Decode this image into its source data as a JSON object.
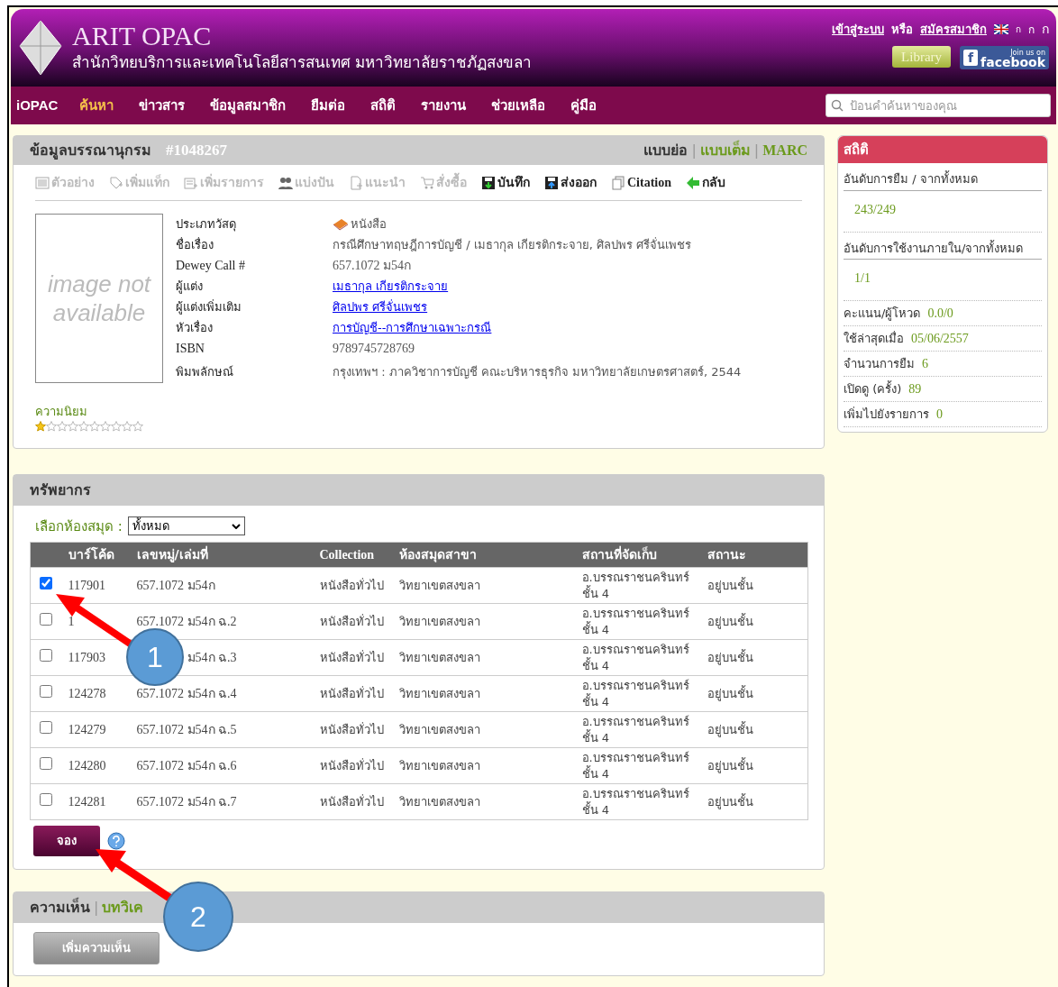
{
  "header": {
    "title": "ARIT OPAC",
    "subtitle": "สำนักวิทยบริการและเทคโนโลยีสารสนเทศ มหาวิทยาลัยราชภัฏสงขลา",
    "login": "เข้าสู่ระบบ",
    "or": "หรือ",
    "register": "สมัครสมาชิก",
    "lang_options": [
      "ก",
      "ก",
      "ก"
    ],
    "library_button": "Library",
    "facebook_letter": "f",
    "facebook_small": "Join us on",
    "facebook": "facebook"
  },
  "nav": {
    "brand": "iOPAC",
    "items": [
      {
        "label": "ค้นหา",
        "selected": true
      },
      {
        "label": "ข่าวสาร",
        "selected": false
      },
      {
        "label": "ข้อมูลสมาชิก",
        "selected": false
      },
      {
        "label": "ยืมต่อ",
        "selected": false
      },
      {
        "label": "สถิติ",
        "selected": false
      },
      {
        "label": "รายงาน",
        "selected": false
      },
      {
        "label": "ช่วยเหลือ",
        "selected": false
      },
      {
        "label": "คู่มือ",
        "selected": false
      }
    ],
    "search": {
      "placeholder": "ป้อนคำค้นหาของคุณ"
    }
  },
  "record": {
    "title": "ข้อมูลบรรณานุกรม",
    "id": "#1048267",
    "views": [
      {
        "label": "แบบย่อ",
        "selected": true
      },
      {
        "label": "แบบเต็ม",
        "selected": false
      },
      {
        "label": "MARC",
        "selected": false
      }
    ],
    "view_separators": [
      "|",
      "|"
    ],
    "toolbar": [
      {
        "kind": "preview",
        "label": "ตัวอย่าง",
        "disabled": true
      },
      {
        "kind": "tag",
        "label": "เพิ่มแท็ก",
        "disabled": true
      },
      {
        "kind": "list",
        "label": "เพิ่มรายการ",
        "disabled": true
      },
      {
        "kind": "share",
        "label": "แบ่งปัน",
        "disabled": true
      },
      {
        "kind": "suggest",
        "label": "แนะนำ",
        "disabled": true
      },
      {
        "kind": "cart",
        "label": "สั่งซื้อ",
        "disabled": true
      },
      {
        "kind": "save",
        "label": "บันทึก",
        "disabled": false
      },
      {
        "kind": "export",
        "label": "ส่งออก",
        "disabled": false
      },
      {
        "kind": "cite",
        "label": "Citation",
        "disabled": false
      },
      {
        "kind": "back",
        "label": "กลับ",
        "disabled": false
      }
    ],
    "image_placeholder": "image not available",
    "fields": [
      {
        "label": "ประเภทวัสดุ",
        "value": "หนังสือ",
        "kind": "book"
      },
      {
        "label": "ชื่อเรื่อง",
        "value": "กรณีศึกษาทฤษฎีการบัญชี / เมธากุล เกียรติกระจาย, ศิลปพร ศรีจั่นเพชร",
        "kind": "text"
      },
      {
        "label": "Dewey Call #",
        "value": "657.1072 ม54ก",
        "kind": "text"
      },
      {
        "label": "ผู้แต่ง",
        "value": "เมธากุล เกียรติกระจาย",
        "kind": "link"
      },
      {
        "label": "ผู้แต่งเพิ่มเติม",
        "value": "ศิลปพร ศรีจั่นเพชร",
        "kind": "link"
      },
      {
        "label": "หัวเรื่อง",
        "value": "การบัญชี--การศึกษาเฉพาะกรณี",
        "kind": "link"
      },
      {
        "label": "ISBN",
        "value": "9789745728769",
        "kind": "text"
      },
      {
        "label": "พิมพลักษณ์",
        "value": "กรุงเทพฯ : ภาควิชาการบัญชี คณะบริหารธุรกิจ มหาวิทยาลัยเกษตรศาสตร์, 2544",
        "kind": "text"
      }
    ],
    "popularity": {
      "label": "ความนิยม",
      "stars": 1
    }
  },
  "stats": {
    "title": "สถิติ",
    "blocks": [
      {
        "label": "อันดับการยืม / จากทั้งหมด",
        "value": "243/249"
      },
      {
        "label": "อันดับการใช้งานภายใน/จากทั้งหมด",
        "value": "1/1"
      }
    ],
    "items": [
      {
        "label": "คะแนน/ผู้โหวด",
        "value": "0.0/0"
      },
      {
        "label": "ใช้ล่าสุดเมื่อ",
        "value": "05/06/2557"
      },
      {
        "label": "จำนวนการยืม",
        "value": "6"
      },
      {
        "label": "เปิดดู (ครั้ง)",
        "value": "89"
      },
      {
        "label": "เพิ่มไปยังรายการ",
        "value": "0"
      }
    ]
  },
  "holdings": {
    "title": "ทรัพยากร",
    "filter_label": "เลือกห้องสมุด :",
    "filter_value": "ทั้งหมด",
    "columns": [
      "บาร์โค้ด",
      "เลขหมู่/เล่มที่",
      "Collection",
      "ห้องสมุดสาขา",
      "สถานที่จัดเก็บ",
      "สถานะ"
    ],
    "rows": [
      {
        "checked": true,
        "barcode": "117901",
        "call": "657.1072 ม54ก",
        "collection": "หนังสือทั่วไป",
        "branch": "วิทยาเขตสงขลา",
        "location": "อ.บรรณราชนครินทร์ ชั้น 4",
        "status": "อยู่บนชั้น"
      },
      {
        "checked": false,
        "barcode": "1",
        "call": "657.1072 ม54ก ฉ.2",
        "collection": "หนังสือทั่วไป",
        "branch": "วิทยาเขตสงขลา",
        "location": "อ.บรรณราชนครินทร์ ชั้น 4",
        "status": "อยู่บนชั้น"
      },
      {
        "checked": false,
        "barcode": "117903",
        "call": "ม54ก ฉ.3",
        "collection": "หนังสือทั่วไป",
        "branch": "วิทยาเขตสงขลา",
        "location": "อ.บรรณราชนครินทร์ ชั้น 4",
        "status": "อยู่บนชั้น"
      },
      {
        "checked": false,
        "barcode": "124278",
        "call": "657.1072 ม54ก ฉ.4",
        "collection": "หนังสือทั่วไป",
        "branch": "วิทยาเขตสงขลา",
        "location": "อ.บรรณราชนครินทร์ ชั้น 4",
        "status": "อยู่บนชั้น"
      },
      {
        "checked": false,
        "barcode": "124279",
        "call": "657.1072 ม54ก ฉ.5",
        "collection": "หนังสือทั่วไป",
        "branch": "วิทยาเขตสงขลา",
        "location": "อ.บรรณราชนครินทร์ ชั้น 4",
        "status": "อยู่บนชั้น"
      },
      {
        "checked": false,
        "barcode": "124280",
        "call": "657.1072 ม54ก ฉ.6",
        "collection": "หนังสือทั่วไป",
        "branch": "วิทยาเขตสงขลา",
        "location": "อ.บรรณราชนครินทร์ ชั้น 4",
        "status": "อยู่บนชั้น"
      },
      {
        "checked": false,
        "barcode": "124281",
        "call": "657.1072 ม54ก ฉ.7",
        "collection": "หนังสือทั่วไป",
        "branch": "วิทยาเขตสงขลา",
        "location": "อ.บรรณราชนครินทร์ ชั้น 4",
        "status": "อยู่บนชั้น"
      }
    ],
    "reserve_button": "จอง"
  },
  "comments": {
    "tabs": [
      {
        "label": "ความเห็น",
        "selected": true
      },
      {
        "label": "บทวิเค",
        "selected": false
      }
    ],
    "tab_separators": [
      "|"
    ],
    "add_button": "เพิ่มความเห็น"
  },
  "annotations": [
    {
      "label": "1"
    },
    {
      "label": "2"
    }
  ]
}
